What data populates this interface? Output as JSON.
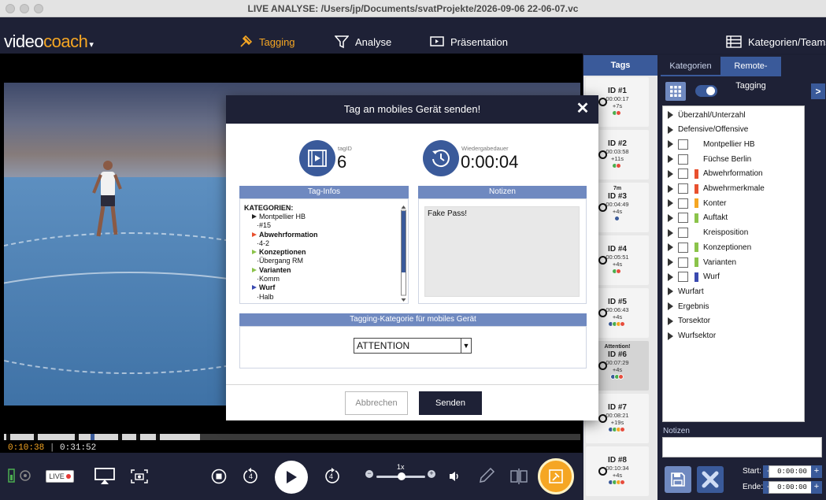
{
  "window": {
    "title": "LIVE ANALYSE: /Users/jp/Documents/svatProjekte/2026-09-06 22-06-07.vc"
  },
  "brand": {
    "name_a": "video",
    "name_b": "coach",
    "caret": "▾"
  },
  "nav": {
    "tagging": "Tagging",
    "analyse": "Analyse",
    "praesentation": "Präsentation",
    "kategorien_teams": "Kategorien/Teams"
  },
  "player": {
    "current_time": "0:10:38",
    "separator": "|",
    "total_time": "0:31:52",
    "speed": "1x",
    "live_label": "LIVE",
    "rewind_seconds": "4",
    "forward_seconds": "4",
    "progress_fraction": 0.34
  },
  "tags": {
    "header": "Tags",
    "items": [
      {
        "note": "",
        "id": "ID #1",
        "time": "00:00:17",
        "dur": "+7s",
        "dots": [
          "#4caf50",
          "#e74c3c"
        ]
      },
      {
        "note": "",
        "id": "ID #2",
        "time": "00:03:58",
        "dur": "+11s",
        "dots": [
          "#4caf50",
          "#e74c3c"
        ]
      },
      {
        "note": "7m",
        "id": "ID #3",
        "time": "00:04:49",
        "dur": "+4s",
        "dots": [
          "#3a5a9a"
        ]
      },
      {
        "note": "",
        "id": "ID #4",
        "time": "00:05:51",
        "dur": "+4s",
        "dots": [
          "#4caf50",
          "#e74c3c"
        ]
      },
      {
        "note": "",
        "id": "ID #5",
        "time": "00:06:43",
        "dur": "+4s",
        "dots": [
          "#3a5a9a",
          "#4caf50",
          "#f5a623",
          "#e74c3c"
        ]
      },
      {
        "note": "Attention!",
        "id": "ID #6",
        "time": "00:07:29",
        "dur": "+4s",
        "dots": [
          "#3a5a9a",
          "#4caf50",
          "#e74c3c"
        ]
      },
      {
        "note": "",
        "id": "ID #7",
        "time": "00:08:21",
        "dur": "+19s",
        "dots": [
          "#3a5a9a",
          "#4caf50",
          "#f5a623",
          "#e74c3c"
        ]
      },
      {
        "note": "",
        "id": "ID #8",
        "time": "00:10:34",
        "dur": "+4s",
        "dots": [
          "#3a5a9a",
          "#4caf50",
          "#f5a623",
          "#e74c3c"
        ]
      }
    ]
  },
  "right_panel": {
    "tab_kategorien": "Kategorien",
    "tab_remote": "Remote-Tagging",
    "expand": ">",
    "categories": [
      {
        "label": "Überzahl/Unterzahl",
        "checkbox": false,
        "color": ""
      },
      {
        "label": "Defensive/Offensive",
        "checkbox": false,
        "color": ""
      },
      {
        "label": "Montpellier HB",
        "checkbox": true,
        "color": ""
      },
      {
        "label": "Füchse Berlin",
        "checkbox": true,
        "color": ""
      },
      {
        "label": "Abwehrformation",
        "checkbox": true,
        "color": "#e8502e"
      },
      {
        "label": "Abwehrmerkmale",
        "checkbox": true,
        "color": "#e8502e"
      },
      {
        "label": "Konter",
        "checkbox": true,
        "color": "#f5a623"
      },
      {
        "label": "Auftakt",
        "checkbox": true,
        "color": "#8bc34a"
      },
      {
        "label": "Kreisposition",
        "checkbox": true,
        "color": ""
      },
      {
        "label": "Konzeptionen",
        "checkbox": true,
        "color": "#8bc34a"
      },
      {
        "label": "Varianten",
        "checkbox": true,
        "color": "#8bc34a"
      },
      {
        "label": "Wurf",
        "checkbox": true,
        "color": "#3a4ab0"
      },
      {
        "label": "Wurfart",
        "checkbox": false,
        "color": ""
      },
      {
        "label": "Ergebnis",
        "checkbox": false,
        "color": ""
      },
      {
        "label": "Torsektor",
        "checkbox": false,
        "color": ""
      },
      {
        "label": "Wurfsektor",
        "checkbox": false,
        "color": ""
      }
    ],
    "notizen_label": "Notizen",
    "start_label": "Start:",
    "ende_label": "Ende:",
    "start_value": "0:00:00",
    "ende_value": "0:00:00",
    "minus": "-",
    "plus": "+"
  },
  "modal": {
    "title": "Tag an mobiles Gerät senden!",
    "close": "✕",
    "tagid_label": "tagID",
    "tagid_value": "6",
    "duration_label": "Wiedergabedauer",
    "duration_value": "0:00:04",
    "taginfos_header": "Tag-Infos",
    "notizen_header": "Notizen",
    "notes_text": "Fake Pass!",
    "tag_info_lines": [
      {
        "text": "KATEGORIEN:",
        "bold": true,
        "arrow": "",
        "indent": 0
      },
      {
        "text": "Montpellier HB",
        "bold": false,
        "arrow": "#222222",
        "indent": 1
      },
      {
        "text": "·#15",
        "bold": false,
        "arrow": "",
        "indent": 2
      },
      {
        "text": "Abwehrformation",
        "bold": true,
        "arrow": "#e8502e",
        "indent": 1
      },
      {
        "text": "·4-2",
        "bold": false,
        "arrow": "",
        "indent": 2
      },
      {
        "text": "Konzeptionen",
        "bold": true,
        "arrow": "#8bc34a",
        "indent": 1
      },
      {
        "text": "·Übergang RM",
        "bold": false,
        "arrow": "",
        "indent": 2
      },
      {
        "text": "Varianten",
        "bold": true,
        "arrow": "#8bc34a",
        "indent": 1
      },
      {
        "text": "·Komm",
        "bold": false,
        "arrow": "",
        "indent": 2
      },
      {
        "text": "Wurf",
        "bold": true,
        "arrow": "#3a4ab0",
        "indent": 1
      },
      {
        "text": "·Halb",
        "bold": false,
        "arrow": "",
        "indent": 2
      }
    ],
    "mobile_cat_header": "Tagging-Kategorie für mobiles Gerät",
    "mobile_cat_value": "ATTENTION",
    "cancel": "Abbrechen",
    "send": "Senden"
  },
  "colors": {
    "accent": "#f5a623",
    "primary": "#3a5a9a",
    "navbar": "#1e2136"
  },
  "icons": {
    "tagging": "tag-pin-icon",
    "analyse": "filter-funnel-icon",
    "praesentation": "presentation-screen-icon",
    "kategorien": "list-grid-icon"
  }
}
